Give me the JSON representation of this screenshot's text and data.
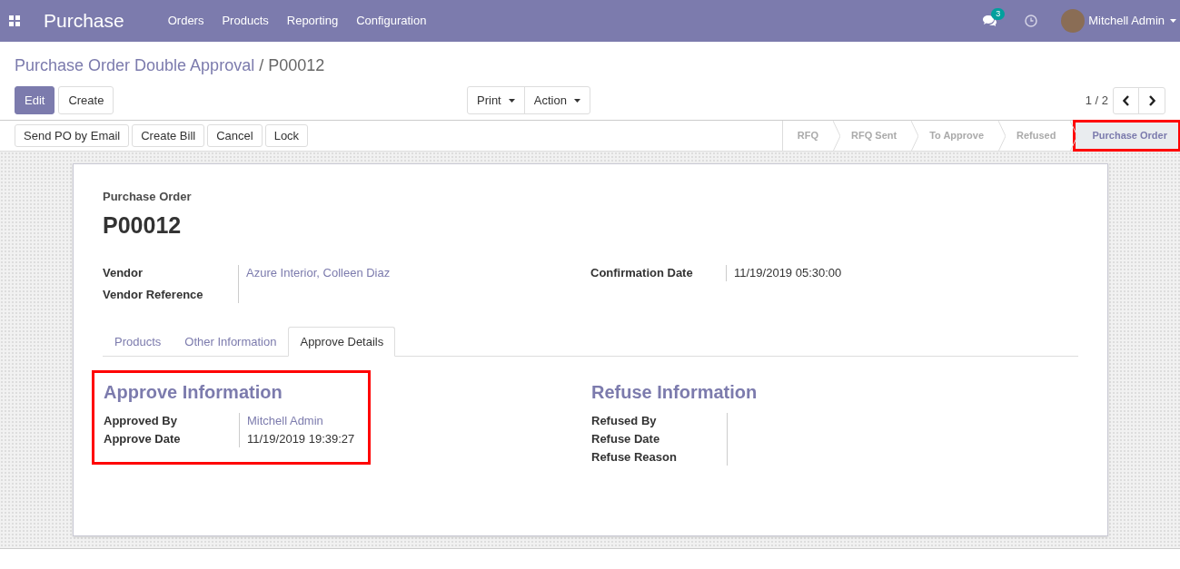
{
  "navbar": {
    "app": "Purchase",
    "menu": [
      "Orders",
      "Products",
      "Reporting",
      "Configuration"
    ],
    "message_count": "3",
    "user": "Mitchell Admin"
  },
  "breadcrumb": {
    "parent": "Purchase Order Double Approval",
    "separator": "/",
    "current": "P00012"
  },
  "control_buttons": [
    {
      "label": "Edit",
      "kind": "primary"
    },
    {
      "label": "Create",
      "kind": "secondary"
    }
  ],
  "dropdowns": [
    "Print",
    "Action"
  ],
  "pager": "1 / 2",
  "header_buttons": [
    "Send PO by Email",
    "Create Bill",
    "Cancel",
    "Lock"
  ],
  "stages": [
    {
      "label": "RFQ",
      "selected": false
    },
    {
      "label": "RFQ Sent",
      "selected": false
    },
    {
      "label": "To Approve",
      "selected": false
    },
    {
      "label": "Refused",
      "selected": false
    },
    {
      "label": "Purchase Order",
      "selected": true,
      "highlighted": true
    }
  ],
  "sheet": {
    "label": "Purchase Order",
    "name": "P00012",
    "left_fields": [
      {
        "label": "Vendor",
        "value": "Azure Interior, Colleen Diaz",
        "kind": "link"
      },
      {
        "label": "Vendor Reference"
      }
    ],
    "right_fields": [
      {
        "label": "Confirmation Date",
        "value": "11/19/2019 05:30:00",
        "kind": "plain"
      }
    ],
    "tabs": [
      {
        "label": "Products",
        "selected": false
      },
      {
        "label": "Other Information",
        "selected": false
      },
      {
        "label": "Approve Details",
        "selected": true
      }
    ],
    "groups": [
      {
        "title": "Approve Information",
        "highlighted": true,
        "fields": [
          {
            "label": "Approved By",
            "value": "Mitchell Admin",
            "kind": "link"
          },
          {
            "label": "Approve Date",
            "value": "11/19/2019 19:39:27",
            "kind": "plain"
          }
        ]
      },
      {
        "title": "Refuse Information",
        "highlighted": false,
        "fields": [
          {
            "label": "Refused By"
          },
          {
            "label": "Refuse Date"
          },
          {
            "label": "Refuse Reason"
          }
        ]
      }
    ]
  }
}
